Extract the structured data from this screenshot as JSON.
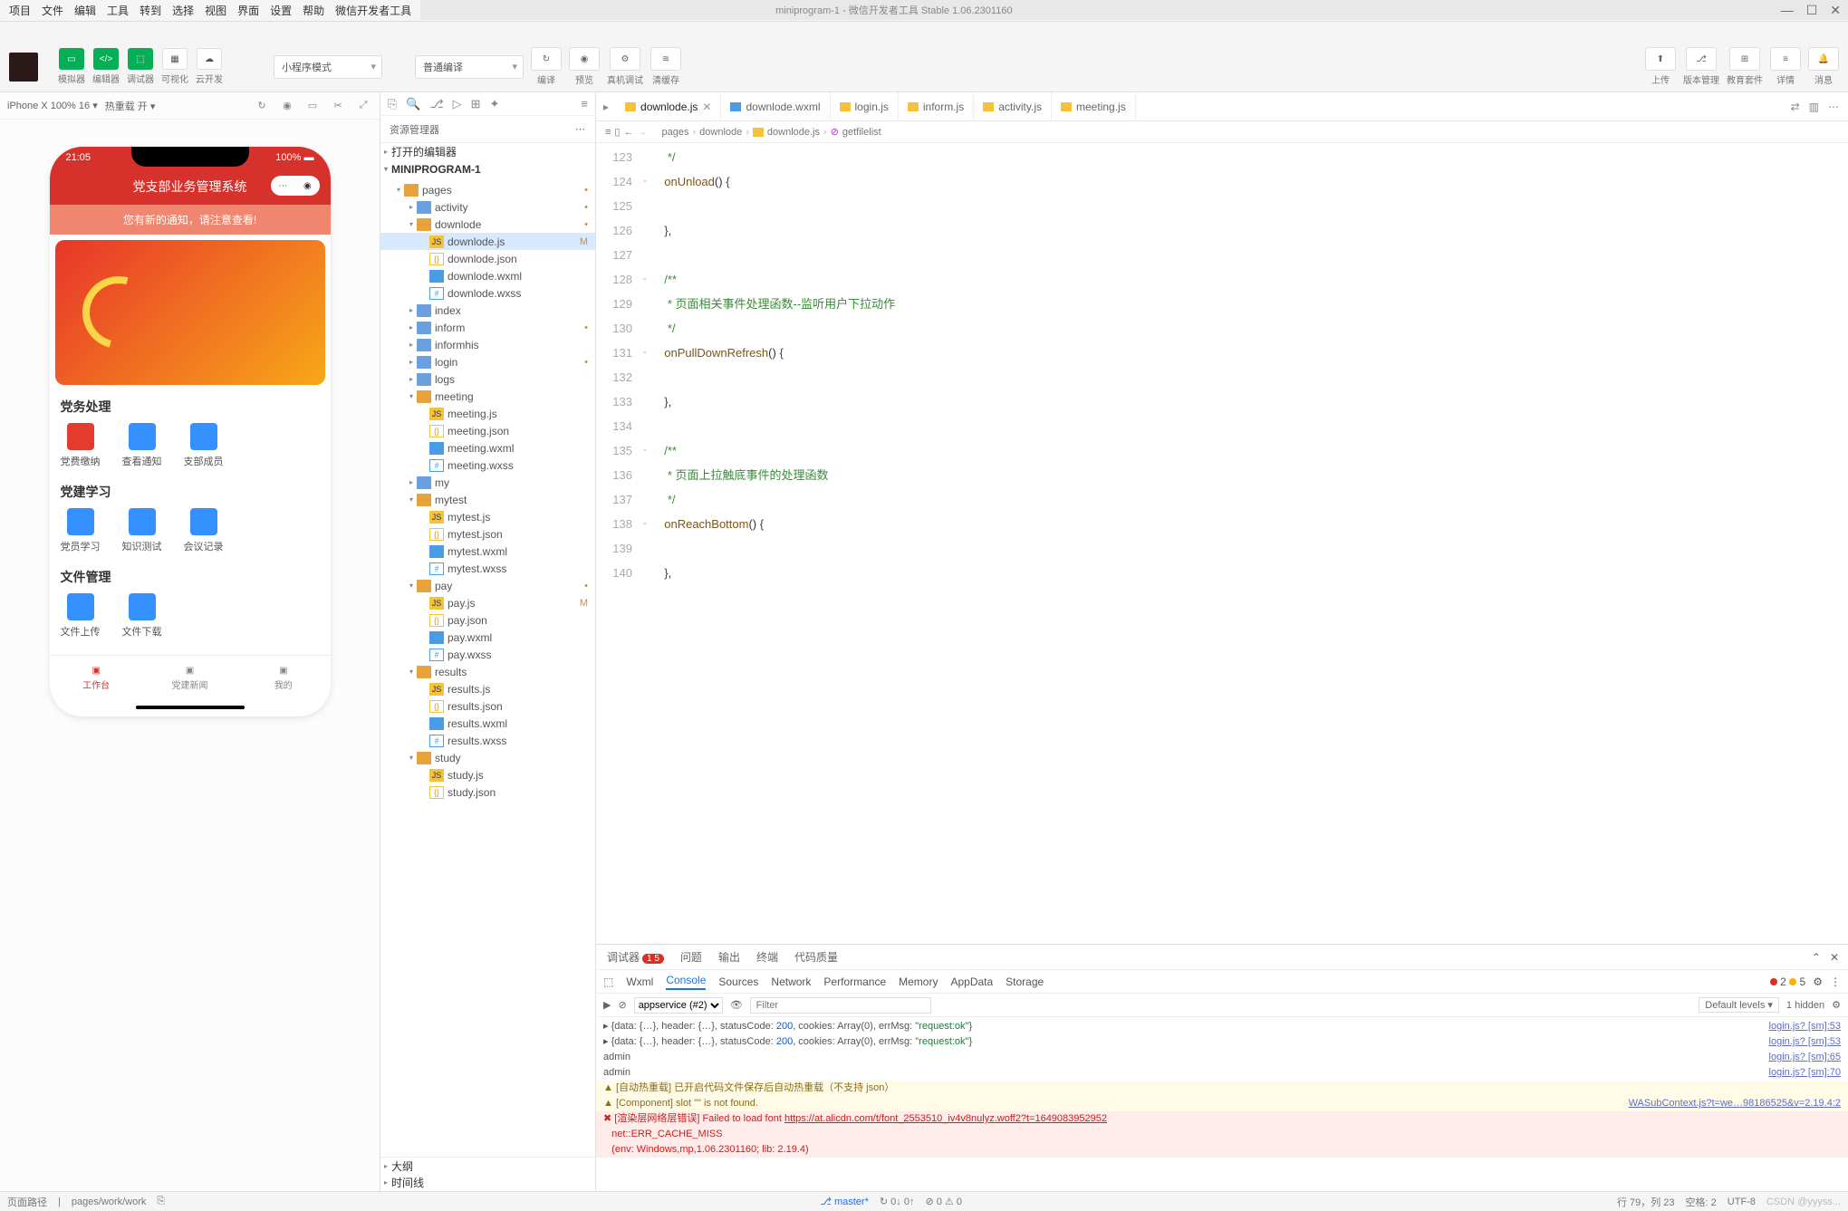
{
  "titlebar": {
    "title": "miniprogram-1 - 微信开发者工具 Stable 1.06.2301160"
  },
  "menubar": [
    "项目",
    "文件",
    "编辑",
    "工具",
    "转到",
    "选择",
    "视图",
    "界面",
    "设置",
    "帮助",
    "微信开发者工具"
  ],
  "toolbar": {
    "labels": {
      "simulator": "模拟器",
      "editor": "编辑器",
      "debugger": "调试器",
      "visualize": "可视化",
      "cloud": "云开发",
      "mode": "小程序模式",
      "compile_select": "普通编译",
      "compile": "编译",
      "preview": "预览",
      "real": "真机调试",
      "clear": "清缓存",
      "upload": "上传",
      "version": "版本管理",
      "edu": "教育套件",
      "detail": "详情",
      "msg": "消息"
    }
  },
  "sim": {
    "device": "iPhone X 100% 16",
    "hot": "热重载 开",
    "time": "21:05",
    "battery": "100%",
    "app_title": "党支部业务管理系统",
    "notice": "您有新的通知，请注意查看!",
    "sections": [
      {
        "title": "党务处理",
        "items": [
          {
            "label": "党费缴纳",
            "color": "red"
          },
          {
            "label": "查看通知",
            "color": ""
          },
          {
            "label": "支部成员",
            "color": ""
          }
        ]
      },
      {
        "title": "党建学习",
        "items": [
          {
            "label": "党员学习",
            "color": ""
          },
          {
            "label": "知识测试",
            "color": ""
          },
          {
            "label": "会议记录",
            "color": ""
          }
        ]
      },
      {
        "title": "文件管理",
        "items": [
          {
            "label": "文件上传",
            "color": ""
          },
          {
            "label": "文件下载",
            "color": ""
          }
        ]
      }
    ],
    "tabs": [
      {
        "label": "工作台",
        "active": true
      },
      {
        "label": "党建新闻",
        "active": false
      },
      {
        "label": "我的",
        "active": false
      }
    ]
  },
  "file_panel": {
    "header": "资源管理器",
    "sections": [
      "打开的编辑器",
      "MINIPROGRAM-1",
      "大纲",
      "时间线"
    ]
  },
  "tree": [
    {
      "d": 1,
      "type": "folder",
      "name": "pages",
      "open": true,
      "status": "•",
      "color": "orange"
    },
    {
      "d": 2,
      "type": "folder",
      "name": "activity",
      "open": false,
      "status": "•"
    },
    {
      "d": 2,
      "type": "folder",
      "name": "downlode",
      "open": true,
      "status": "•",
      "color": "orange"
    },
    {
      "d": 3,
      "type": "js",
      "name": "downlode.js",
      "status": "M",
      "selected": true
    },
    {
      "d": 3,
      "type": "json",
      "name": "downlode.json"
    },
    {
      "d": 3,
      "type": "wxml",
      "name": "downlode.wxml"
    },
    {
      "d": 3,
      "type": "wxss",
      "name": "downlode.wxss"
    },
    {
      "d": 2,
      "type": "folder",
      "name": "index",
      "open": false
    },
    {
      "d": 2,
      "type": "folder",
      "name": "inform",
      "open": false,
      "status": "•"
    },
    {
      "d": 2,
      "type": "folder",
      "name": "informhis",
      "open": false
    },
    {
      "d": 2,
      "type": "folder",
      "name": "login",
      "open": false,
      "status": "•"
    },
    {
      "d": 2,
      "type": "folder",
      "name": "logs",
      "open": false
    },
    {
      "d": 2,
      "type": "folder",
      "name": "meeting",
      "open": true,
      "color": "orange"
    },
    {
      "d": 3,
      "type": "js",
      "name": "meeting.js"
    },
    {
      "d": 3,
      "type": "json",
      "name": "meeting.json"
    },
    {
      "d": 3,
      "type": "wxml",
      "name": "meeting.wxml"
    },
    {
      "d": 3,
      "type": "wxss",
      "name": "meeting.wxss"
    },
    {
      "d": 2,
      "type": "folder",
      "name": "my",
      "open": false
    },
    {
      "d": 2,
      "type": "folder",
      "name": "mytest",
      "open": true,
      "color": "orange"
    },
    {
      "d": 3,
      "type": "js",
      "name": "mytest.js"
    },
    {
      "d": 3,
      "type": "json",
      "name": "mytest.json"
    },
    {
      "d": 3,
      "type": "wxml",
      "name": "mytest.wxml"
    },
    {
      "d": 3,
      "type": "wxss",
      "name": "mytest.wxss"
    },
    {
      "d": 2,
      "type": "folder",
      "name": "pay",
      "open": true,
      "status": "•",
      "color": "orange"
    },
    {
      "d": 3,
      "type": "js",
      "name": "pay.js",
      "status": "M"
    },
    {
      "d": 3,
      "type": "json",
      "name": "pay.json"
    },
    {
      "d": 3,
      "type": "wxml",
      "name": "pay.wxml"
    },
    {
      "d": 3,
      "type": "wxss",
      "name": "pay.wxss"
    },
    {
      "d": 2,
      "type": "folder",
      "name": "results",
      "open": true,
      "color": "orange"
    },
    {
      "d": 3,
      "type": "js",
      "name": "results.js"
    },
    {
      "d": 3,
      "type": "json",
      "name": "results.json"
    },
    {
      "d": 3,
      "type": "wxml",
      "name": "results.wxml"
    },
    {
      "d": 3,
      "type": "wxss",
      "name": "results.wxss"
    },
    {
      "d": 2,
      "type": "folder",
      "name": "study",
      "open": true,
      "color": "orange"
    },
    {
      "d": 3,
      "type": "js",
      "name": "study.js"
    },
    {
      "d": 3,
      "type": "json",
      "name": "study.json"
    }
  ],
  "editor": {
    "tabs": [
      {
        "name": "downlode.js",
        "type": "js",
        "active": true,
        "close": true
      },
      {
        "name": "downlode.wxml",
        "type": "wxml"
      },
      {
        "name": "login.js",
        "type": "js"
      },
      {
        "name": "inform.js",
        "type": "js"
      },
      {
        "name": "activity.js",
        "type": "js"
      },
      {
        "name": "meeting.js",
        "type": "js"
      }
    ],
    "breadcrumb": [
      "pages",
      "downlode",
      "downlode.js",
      "getfilelist"
    ],
    "lines": [
      {
        "n": 123,
        "html": "   <span class='tok-comment'>*/</span>"
      },
      {
        "n": 124,
        "fold": "v",
        "html": "  <span class='tok-fn'>onUnload</span><span class='tok-punct'>()</span> <span class='tok-brace'>{</span>"
      },
      {
        "n": 125,
        "html": ""
      },
      {
        "n": 126,
        "html": "  <span class='tok-brace'>}</span><span class='tok-punct'>,</span>"
      },
      {
        "n": 127,
        "html": ""
      },
      {
        "n": 128,
        "fold": "v",
        "html": "  <span class='tok-comment'>/**</span>"
      },
      {
        "n": 129,
        "html": "   <span class='tok-comment'>* 页面相关事件处理函数--监听用户下拉动作</span>"
      },
      {
        "n": 130,
        "html": "   <span class='tok-comment'>*/</span>"
      },
      {
        "n": 131,
        "fold": "v",
        "html": "  <span class='tok-fn'>onPullDownRefresh</span><span class='tok-punct'>()</span> <span class='tok-brace'>{</span>"
      },
      {
        "n": 132,
        "html": ""
      },
      {
        "n": 133,
        "html": "  <span class='tok-brace'>}</span><span class='tok-punct'>,</span>"
      },
      {
        "n": 134,
        "html": ""
      },
      {
        "n": 135,
        "fold": "v",
        "html": "  <span class='tok-comment'>/**</span>"
      },
      {
        "n": 136,
        "html": "   <span class='tok-comment'>* 页面上拉触底事件的处理函数</span>"
      },
      {
        "n": 137,
        "html": "   <span class='tok-comment'>*/</span>"
      },
      {
        "n": 138,
        "fold": "v",
        "html": "  <span class='tok-fn'>onReachBottom</span><span class='tok-punct'>()</span> <span class='tok-brace'>{</span>"
      },
      {
        "n": 139,
        "html": ""
      },
      {
        "n": 140,
        "html": "  <span class='tok-brace'>}</span><span class='tok-punct'>,</span>"
      }
    ]
  },
  "console": {
    "tabs": {
      "debugger": "调试器",
      "badge": "1 5",
      "issue": "问题",
      "output": "输出",
      "terminal": "终端",
      "quality": "代码质量"
    },
    "devtabs": [
      "Wxml",
      "Console",
      "Sources",
      "Network",
      "Performance",
      "Memory",
      "AppData",
      "Storage"
    ],
    "counts": {
      "err": "2",
      "warn": "5"
    },
    "filter": {
      "context": "appservice (#2)",
      "placeholder": "Filter",
      "levels": "Default levels ▾",
      "hidden": "1 hidden"
    },
    "logs": [
      {
        "type": "log",
        "msg": "▸ {data: {…}, header: {…}, statusCode: <span class='hl-num'>200</span>, cookies: Array(0), errMsg: <span class='hl-green'>\"request:ok\"</span>}",
        "src": "login.js? [sm]:53"
      },
      {
        "type": "log",
        "msg": "▸ {data: {…}, header: {…}, statusCode: <span class='hl-num'>200</span>, cookies: Array(0), errMsg: <span class='hl-green'>\"request:ok\"</span>}",
        "src": "login.js? [sm]:53"
      },
      {
        "type": "log",
        "msg": "admin",
        "src": "login.js? [sm]:65"
      },
      {
        "type": "log",
        "msg": "admin",
        "src": "login.js? [sm]:70"
      },
      {
        "type": "warn",
        "msg": "▲ [自动热重载] 已开启代码文件保存后自动热重载（不支持 json）",
        "src": ""
      },
      {
        "type": "warn",
        "msg": "▲ [Component] slot \"\" is not found.",
        "src": "WASubContext.js?t=we…98186525&v=2.19.4:2"
      },
      {
        "type": "error",
        "msg": "✖ [渲染层网络层错误] Failed to load font <u>https://at.alicdn.com/t/font_2553510_iv4v8nulyz.woff2?t=1649083952952</u><br>&nbsp;&nbsp;&nbsp;net::ERR_CACHE_MISS<br>&nbsp;&nbsp;&nbsp;(env: Windows,mp,1.06.2301160; lib: 2.19.4)",
        "src": ""
      }
    ]
  },
  "status": {
    "path_label": "页面路径",
    "path": "pages/work/work",
    "branch": "master*",
    "sync": "↻ 0↓ 0↑",
    "errwarn": "⊘ 0 ⚠ 0",
    "pos": "行 79，列 23",
    "spaces": "空格: 2",
    "enc": "UTF-8",
    "watermark": "CSDN @yyyss..."
  }
}
